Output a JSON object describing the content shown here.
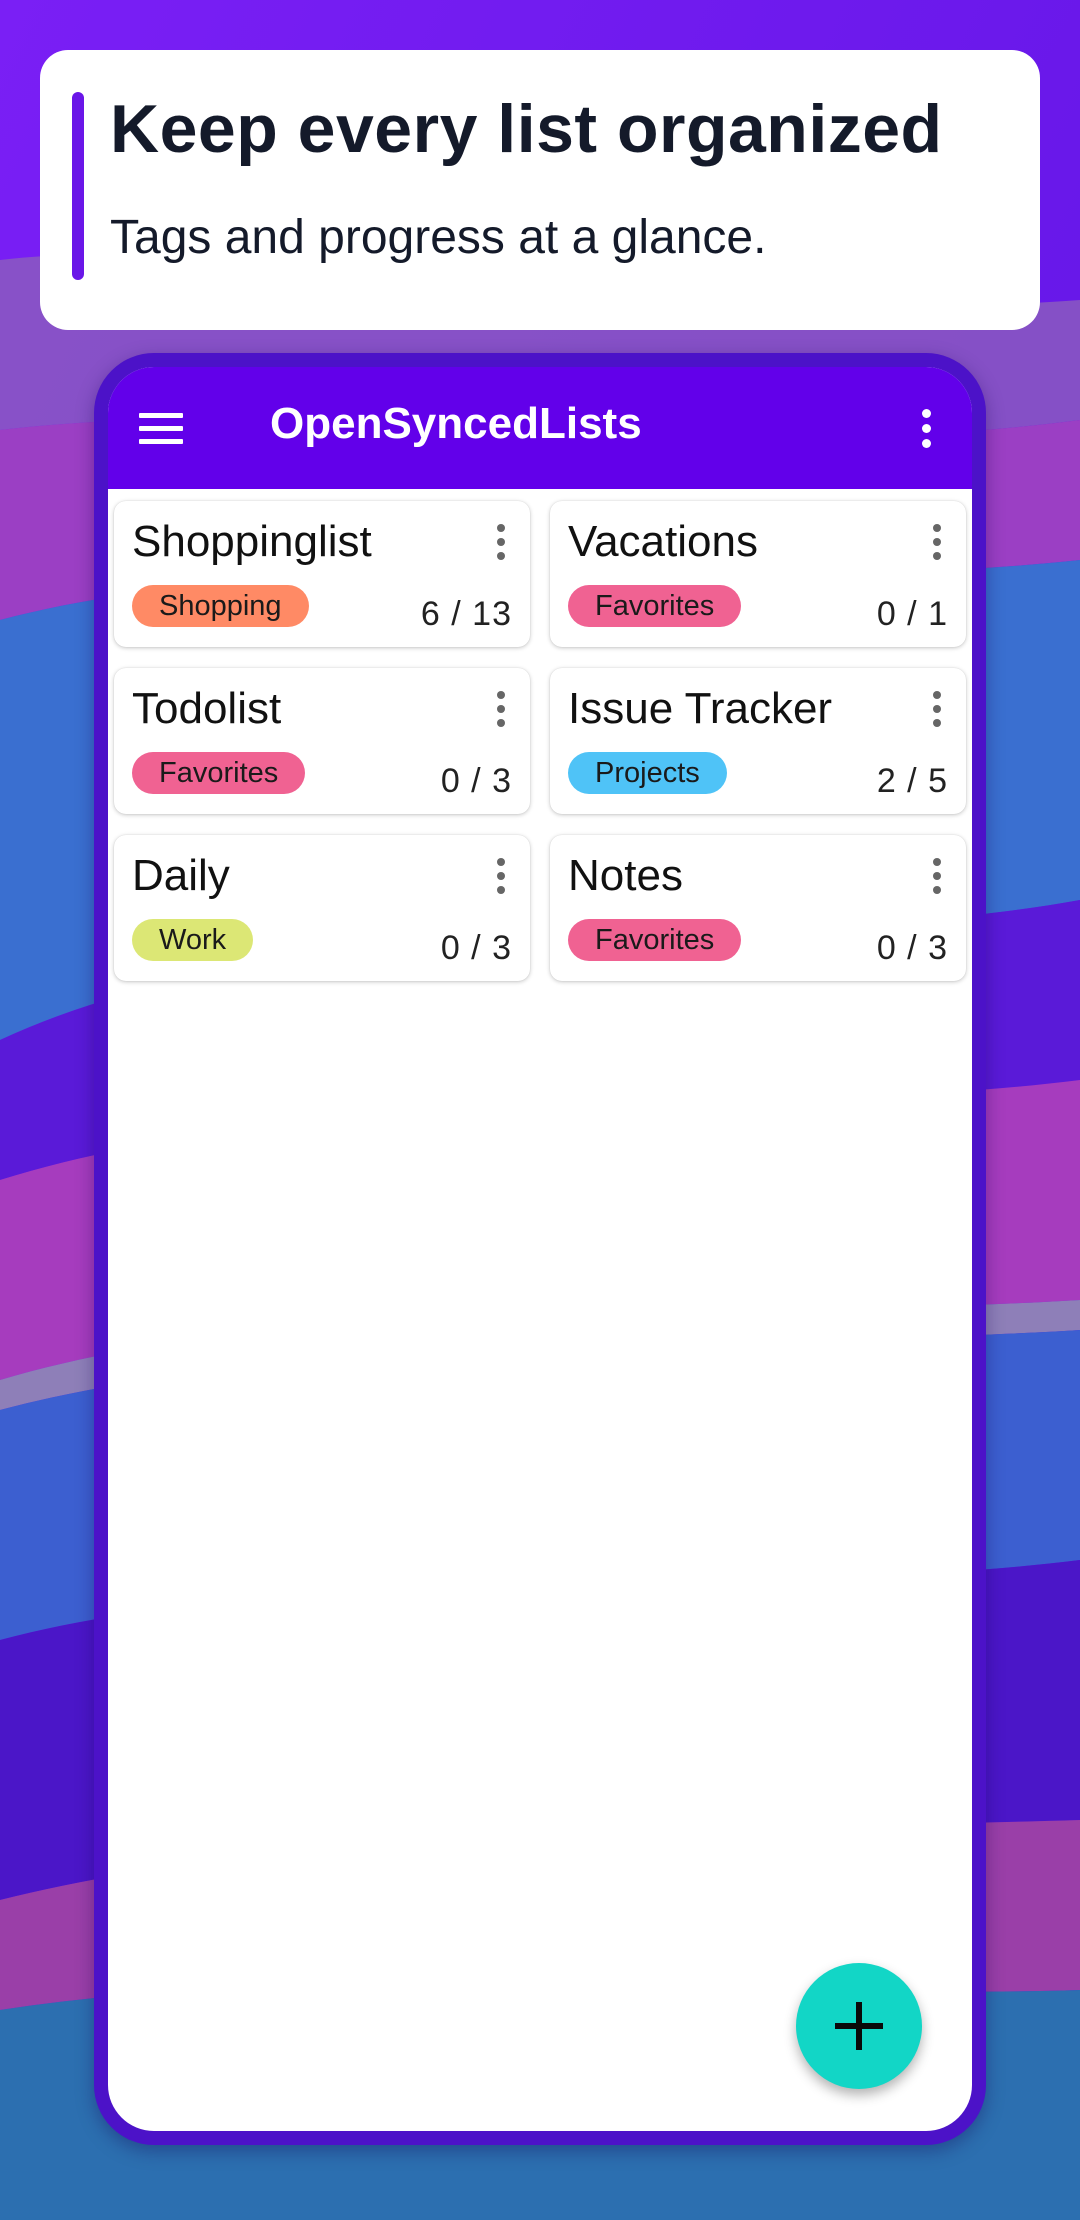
{
  "promo": {
    "headline": "Keep every list organized",
    "subheadline": "Tags and progress at a glance."
  },
  "appbar": {
    "title": "OpenSyncedLists",
    "menu_icon": "hamburger-menu-icon",
    "overflow_icon": "more-vert-icon"
  },
  "lists": [
    {
      "name": "Shoppinglist",
      "tag": "Shopping",
      "tag_color": "#ff8a65",
      "progress": "6 / 13"
    },
    {
      "name": "Vacations",
      "tag": "Favorites",
      "tag_color": "#f06292",
      "progress": "0 / 1"
    },
    {
      "name": "Todolist",
      "tag": "Favorites",
      "tag_color": "#f06292",
      "progress": "0 / 3"
    },
    {
      "name": "Issue Tracker",
      "tag": "Projects",
      "tag_color": "#4fc3f7",
      "progress": "2 / 5"
    },
    {
      "name": "Daily",
      "tag": "Work",
      "tag_color": "#dce775",
      "progress": "0 / 3"
    },
    {
      "name": "Notes",
      "tag": "Favorites",
      "tag_color": "#f06292",
      "progress": "0 / 3"
    }
  ],
  "fab": {
    "icon": "plus-icon",
    "color": "#12d6c6"
  },
  "colors": {
    "primary": "#6200ea",
    "frame": "#4c12c8",
    "accent_bar": "#6a16e8"
  }
}
